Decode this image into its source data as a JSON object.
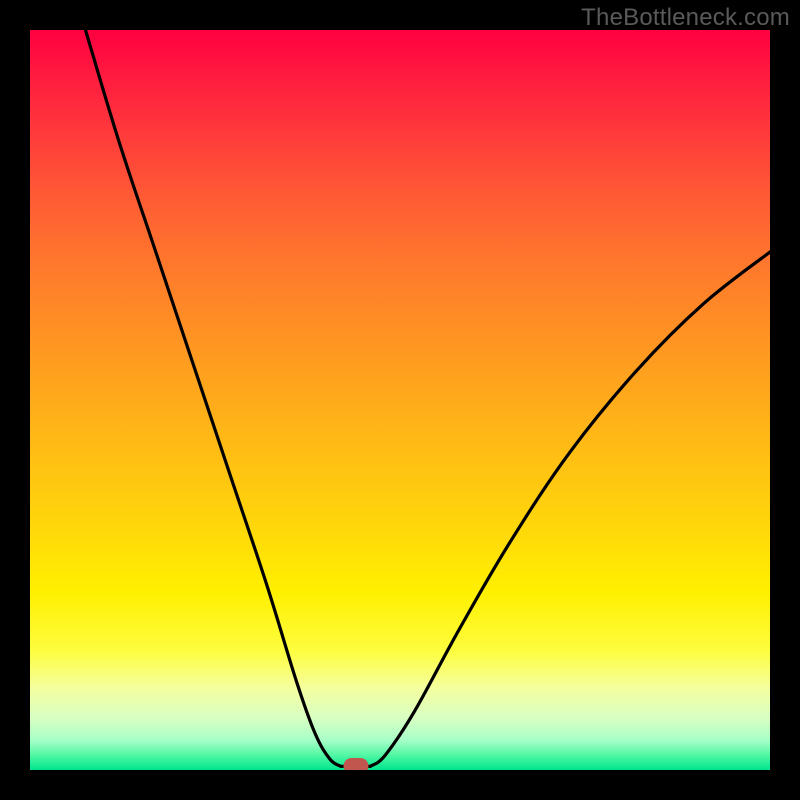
{
  "watermark": "TheBottleneck.com",
  "colors": {
    "background": "#000000",
    "curve": "#000000",
    "marker": "#c1564f",
    "watermark": "#5a5a5a"
  },
  "chart_data": {
    "type": "line",
    "title": "",
    "xlabel": "",
    "ylabel": "",
    "xlim": [
      0,
      100
    ],
    "ylim": [
      0,
      100
    ],
    "grid": false,
    "legend": false,
    "series": [
      {
        "name": "bottleneck-curve-left",
        "x": [
          7.5,
          12,
          17,
          22,
          27,
          32,
          36,
          38.5,
          40.5,
          42
        ],
        "values": [
          100,
          85,
          70,
          55,
          40,
          25,
          12,
          5,
          1.5,
          0.5
        ]
      },
      {
        "name": "bottleneck-curve-right",
        "x": [
          46,
          48,
          52,
          58,
          65,
          73,
          82,
          91,
          100
        ],
        "values": [
          0.5,
          2,
          8,
          19,
          31,
          43,
          54,
          63,
          70
        ]
      }
    ],
    "annotations": [
      {
        "name": "optimal-marker",
        "x": 44,
        "y": 0.5
      }
    ]
  },
  "layout": {
    "frame": 30,
    "plot_size": 740
  }
}
